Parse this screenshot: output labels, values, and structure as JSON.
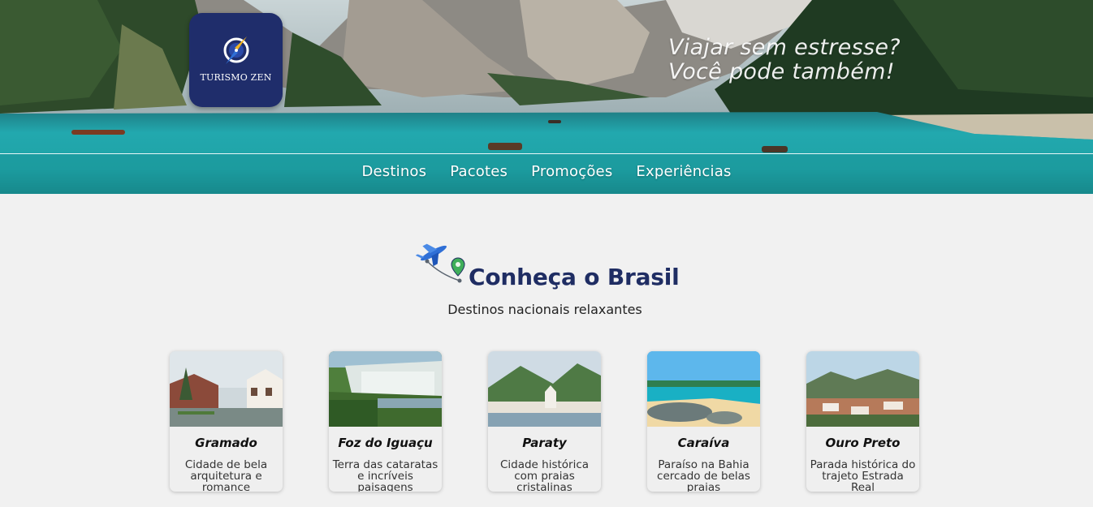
{
  "hero": {
    "logo_text": "TURISMO ZEN",
    "tagline_line1": "Viajar sem estresse?",
    "tagline_line2": "Você pode também!"
  },
  "nav": {
    "items": [
      "Destinos",
      "Pacotes",
      "Promoções",
      "Experiências"
    ]
  },
  "section": {
    "title": "Conheça o Brasil",
    "subtitle": "Destinos nacionais relaxantes",
    "icon": "plane-route-icon"
  },
  "destinations": [
    {
      "name": "Gramado",
      "description": "Cidade de bela arquitetura e romance"
    },
    {
      "name": "Foz do Iguaçu",
      "description": "Terra das cataratas e incríveis paisagens"
    },
    {
      "name": "Paraty",
      "description": "Cidade histórica com praias cristalinas"
    },
    {
      "name": "Caraíva",
      "description": "Paraíso na Bahia cercado de belas praias"
    },
    {
      "name": "Ouro Preto",
      "description": "Parada histórica do trajeto Estrada Real"
    }
  ],
  "colors": {
    "brand_navy": "#1f2d6b",
    "heading": "#1f2d63",
    "page_background": "#f1f1f1"
  }
}
